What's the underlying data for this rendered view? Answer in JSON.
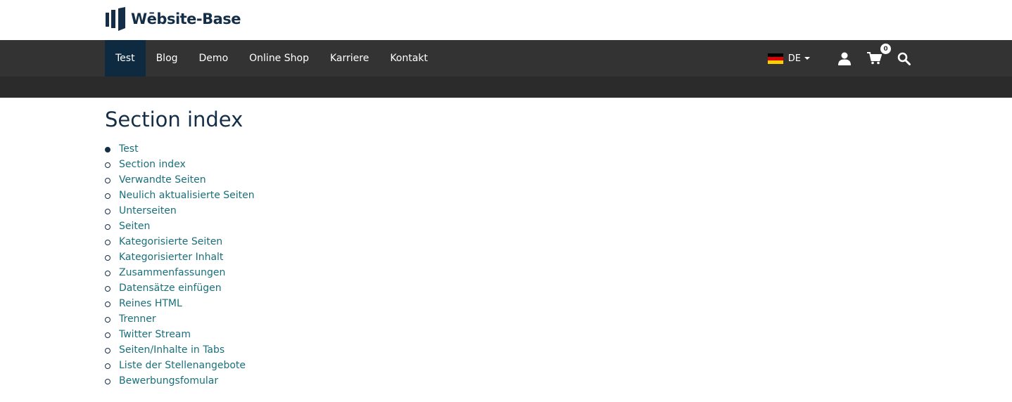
{
  "header": {
    "logo_text": "Wēbsite-Base"
  },
  "nav": {
    "items": [
      {
        "label": "Test",
        "active": true
      },
      {
        "label": "Blog"
      },
      {
        "label": "Demo"
      },
      {
        "label": "Online Shop"
      },
      {
        "label": "Karriere"
      },
      {
        "label": "Kontakt"
      }
    ],
    "language": "DE",
    "cart_count": "0"
  },
  "main": {
    "title": "Section index",
    "links": [
      "Test",
      "Section index",
      "Verwandte Seiten",
      "Neulich aktualisierte Seiten",
      "Unterseiten",
      "Seiten",
      "Kategorisierte Seiten",
      "Kategorisierter Inhalt",
      "Zusammenfassungen",
      "Datensätze einfügen",
      "Reines HTML",
      "Trenner",
      "Twitter Stream",
      "Seiten/Inhalte in Tabs",
      "Liste der Stellenangebote",
      "Bewerbungsfomular"
    ]
  },
  "colors": {
    "brand": "#152e48",
    "nav_bg": "#333333",
    "nav_active": "#0d2a40",
    "link": "#1a6f7b"
  }
}
